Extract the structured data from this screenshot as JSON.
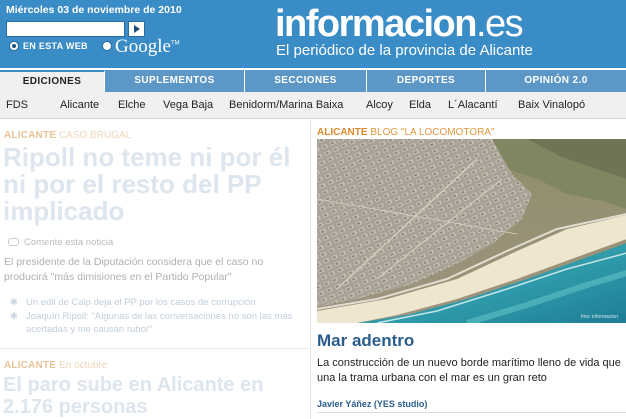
{
  "header": {
    "date": "Miércoles 03 de noviembre de 2010",
    "search": {
      "value": "",
      "placeholder": ""
    },
    "radio_web_label": "EN ESTA WEB",
    "google_label": "Google",
    "logo_name": "informacion",
    "logo_tld": ".es",
    "tagline": "El periódico de la provincia de Alicante"
  },
  "nav": {
    "tabs": [
      {
        "label": "EDICIONES",
        "active": true
      },
      {
        "label": "SUPLEMENTOS",
        "active": false
      },
      {
        "label": "SECCIONES",
        "active": false
      },
      {
        "label": "DEPORTES",
        "active": false
      },
      {
        "label": "OPINIÓN 2.0",
        "active": false
      }
    ],
    "subitems": [
      "FDS",
      "Alicante",
      "Elche",
      "Vega Baja",
      "Benidorm/Marina Baixa",
      "Alcoy",
      "Elda",
      "L´Alacantí",
      "Baix Vinalopó"
    ]
  },
  "left": {
    "story1": {
      "kicker_section": "ALICANTE",
      "kicker_topic": "CASO BRUGAL",
      "headline": "Ripoll no teme ni por él ni por el resto del PP implicado",
      "comment_link": "Comente esta noticia",
      "summary": "El presidente de la Diputación considera que el caso no producirá \"más dimisiones en el Partido Popular\"",
      "related": [
        "Un edil de Calp deja el PP por los casos de corrupción",
        "Joaquín Ripoll: \"Algunas de las conversaciones no son las más acertadas y me causan rubor\""
      ]
    },
    "story2": {
      "kicker_section": "ALICANTE",
      "kicker_topic": "En octubre",
      "headline": "El paro sube en Alicante en 2.176 personas"
    }
  },
  "right": {
    "kicker_section": "ALICANTE",
    "kicker_topic": "BLOG \"LA LOCOMOTORA\"",
    "photo_credit": "foto: informacion",
    "headline": "Mar adentro",
    "summary": "La construcción de un nuevo borde marítimo lleno de vida que una la trama urbana con el mar es un gran reto",
    "byline": "Javier Yáñez (YES studio)"
  },
  "colors": {
    "header_blue": "#3a8cc6",
    "nav_blue": "#5d97c6",
    "headline_blue": "#2a5d8c",
    "kicker_orange": "#d98a2b"
  },
  "icons": [
    "go-arrow-icon",
    "comment-icon",
    "bullet-icon"
  ]
}
